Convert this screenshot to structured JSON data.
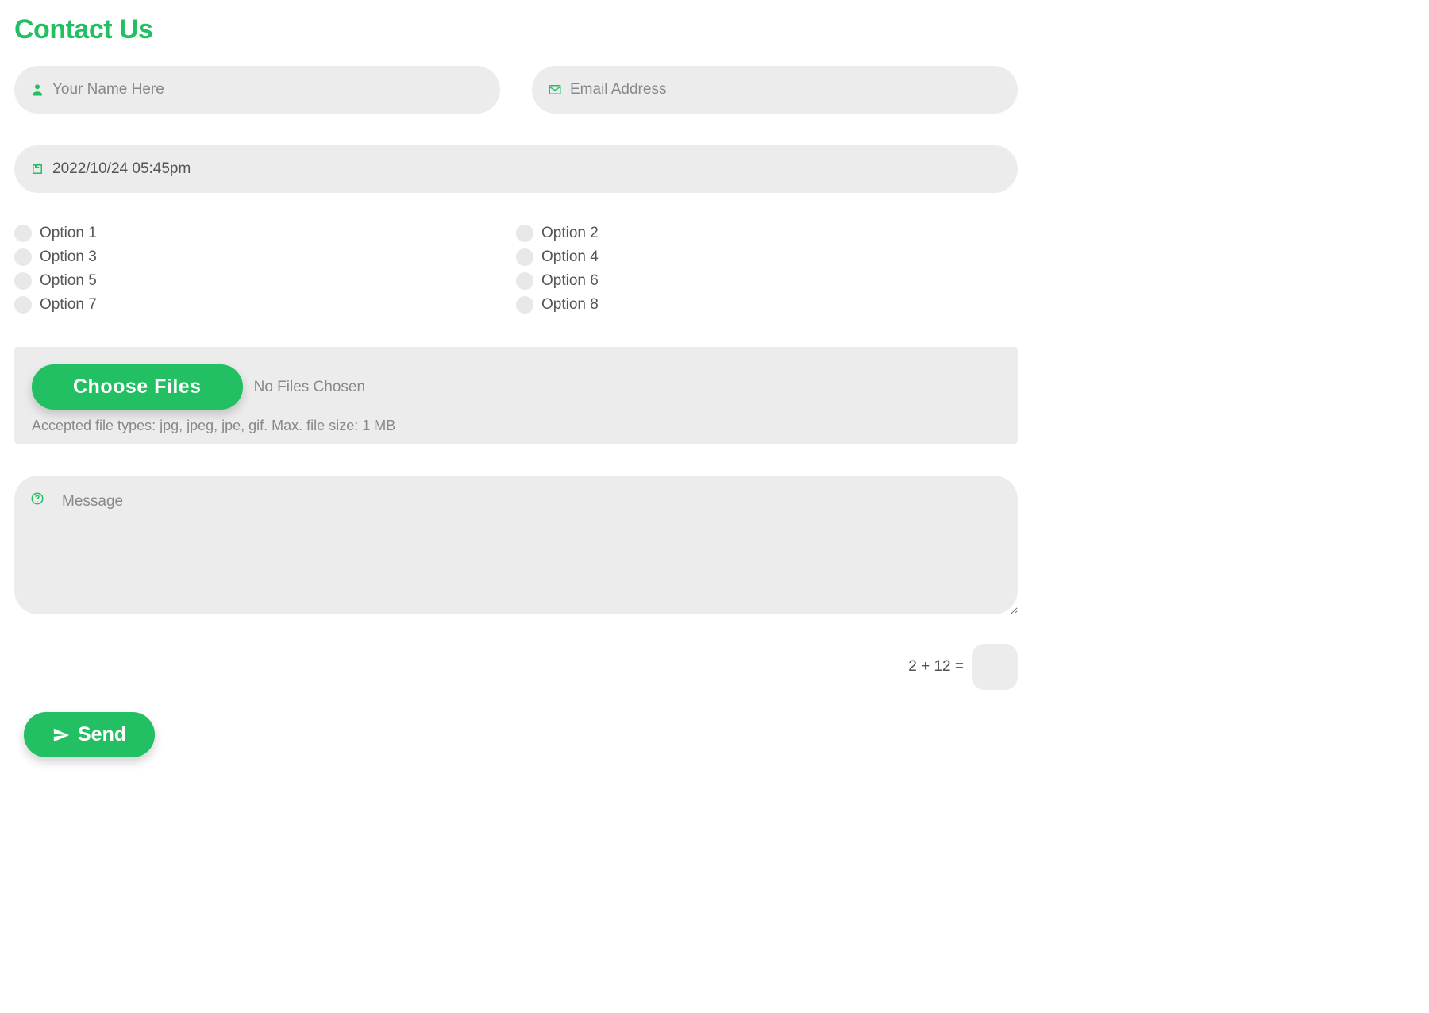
{
  "title": "Contact Us",
  "name": {
    "placeholder": "Your Name Here"
  },
  "email": {
    "placeholder": "Email Address"
  },
  "datetime": {
    "value": "2022/10/24 05:45pm"
  },
  "options": [
    "Option 1",
    "Option 2",
    "Option 3",
    "Option 4",
    "Option 5",
    "Option 6",
    "Option 7",
    "Option 8"
  ],
  "file": {
    "button_label": "Choose Files",
    "status": "No Files Chosen",
    "accepted": "Accepted file types: jpg, jpeg, jpe, gif. Max. file size: 1 MB"
  },
  "message": {
    "placeholder": "Message"
  },
  "captcha": {
    "question": "2 + 12 ="
  },
  "submit": {
    "label": "Send"
  }
}
